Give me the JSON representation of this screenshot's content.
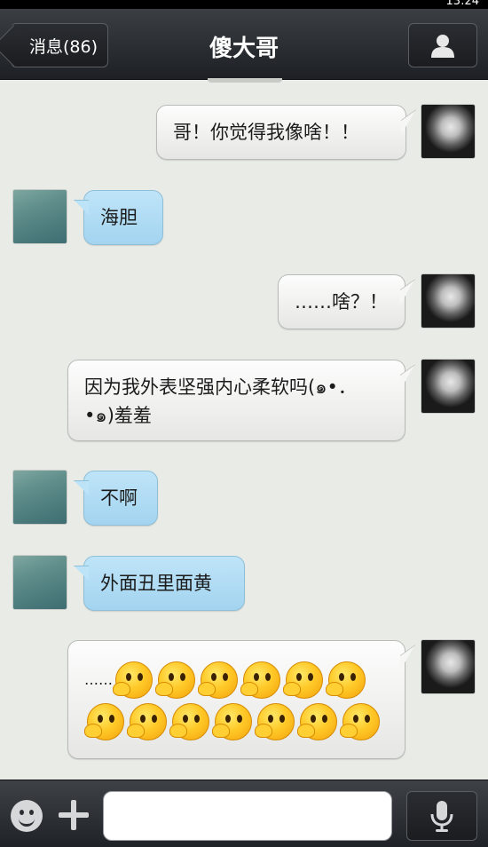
{
  "status_bar": {
    "time": "13:24"
  },
  "header": {
    "back_label": "消息(86)",
    "title": "傻大哥",
    "profile_icon": "person-icon"
  },
  "messages": [
    {
      "side": "right",
      "text": "哥！你觉得我像啥！！"
    },
    {
      "side": "left",
      "text": "海胆"
    },
    {
      "side": "right",
      "text": "……啥？！"
    },
    {
      "side": "right",
      "text_line1": "因为我外表坚强内心柔软吗(๑•．",
      "text_line2": "•๑)羞羞"
    },
    {
      "side": "left",
      "text": "不啊"
    },
    {
      "side": "left",
      "text": "外面丑里面黄"
    },
    {
      "side": "right",
      "text": "……",
      "emoji": "thinking-face-emoji",
      "emoji_count": 13
    }
  ],
  "input_bar": {
    "emoji_icon": "smiley-icon",
    "plus_icon": "plus-icon",
    "input_value": "",
    "voice_icon": "microphone-icon"
  },
  "colors": {
    "background": "#e9ebe6",
    "bubble_self": "#f2f2f1",
    "bubble_other": "#b1dcf4",
    "header": "#2b2e32"
  }
}
